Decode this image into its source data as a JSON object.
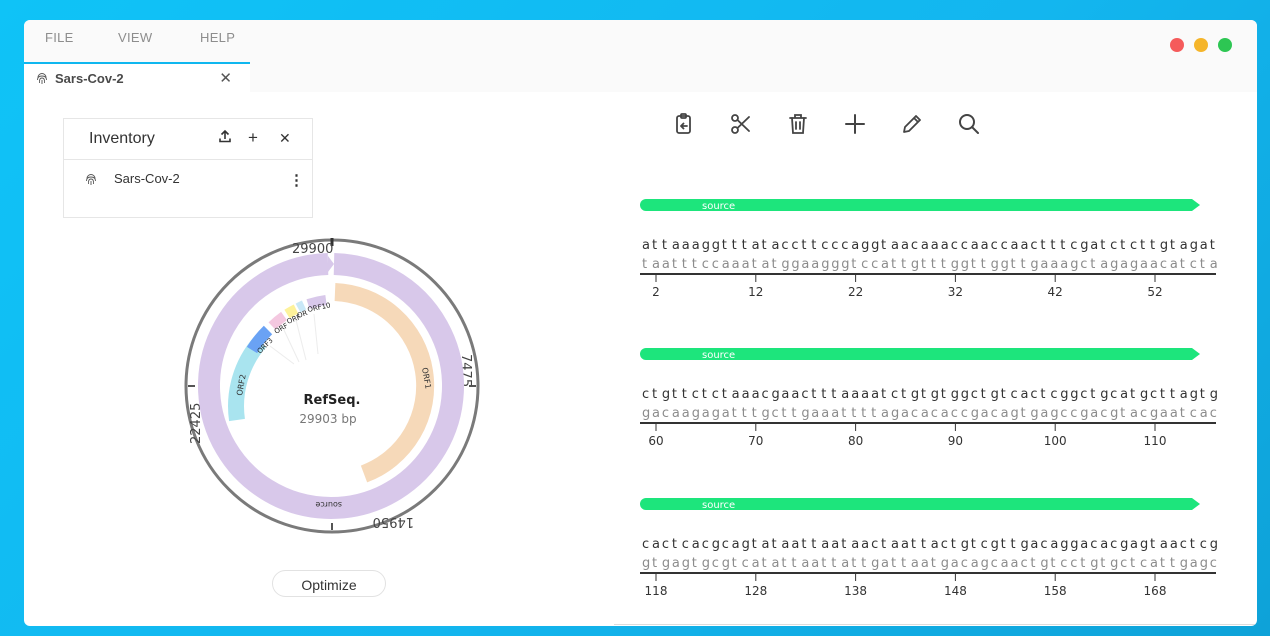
{
  "menu": {
    "items": [
      "FILE",
      "VIEW",
      "HELP"
    ]
  },
  "window_controls": {
    "colors": [
      "#f55b5b",
      "#f5b52a",
      "#2dc653"
    ]
  },
  "tab": {
    "label": "Sars-Cov-2",
    "close": "✕"
  },
  "inventory": {
    "title": "Inventory",
    "upload_icon": "upload-icon",
    "add": "+",
    "close": "✕",
    "items": [
      {
        "label": "Sars-Cov-2",
        "more": "⋮"
      }
    ]
  },
  "plasmid": {
    "name": "RefSeq.",
    "length": "29903 bp",
    "ticks": [
      "29900",
      "7475",
      "14950",
      "22425"
    ],
    "features": [
      {
        "label": "source",
        "color": "#d8c8ea"
      },
      {
        "label": "ORF1",
        "color": "#f6d9b9"
      },
      {
        "label": "ORF2",
        "color": "#a9e4ef"
      },
      {
        "label": "ORF3",
        "color": "#6aa2f4"
      },
      {
        "label": "ORF",
        "color": "#f4c8e0"
      },
      {
        "label": "ORF",
        "color": "#fdf29b"
      },
      {
        "label": "OR",
        "color": "#c9e8f7"
      },
      {
        "label": "ORF10",
        "color": "#d8c8ea"
      }
    ]
  },
  "optimize_button": "Optimize",
  "toolbar": {
    "icons": [
      "paste-icon",
      "scissors-icon",
      "trash-icon",
      "plus-icon",
      "pencil-icon",
      "search-icon"
    ]
  },
  "sequence_rows": [
    {
      "feature": "source",
      "top": "attaaaggtttataccttcccaggtaacaaaccaaccaactttcgatctcttgtagat",
      "bottom": "taatttccaaatatggaagggtccattgtttggttggttgaaagctagagaacatcta",
      "ticks": [
        "2",
        "12",
        "22",
        "32",
        "42",
        "52"
      ]
    },
    {
      "feature": "source",
      "top": "ctgttctctaaacgaactttaaaatctgtgtggctgtcactcggctgcatgcttagtg",
      "bottom": "gacaagagatttgcttgaaattttagacacaccgacagtgagccgacgtacgaatcac",
      "ticks": [
        "60",
        "70",
        "80",
        "90",
        "100",
        "110"
      ]
    },
    {
      "feature": "source",
      "top": "cactcacgcagtataattaataactaattactgtcgttgacaggacacgagtaactcg",
      "bottom": "gtgagtgcgtcatattaattattgattaatgacagcaactgtcctgtgctcattgagc",
      "ticks": [
        "118",
        "128",
        "138",
        "148",
        "158",
        "168"
      ]
    }
  ],
  "colors": {
    "accent": "#0fb7ef",
    "feature_bar": "#1de57c",
    "source_ring": "#d8c8ea"
  }
}
